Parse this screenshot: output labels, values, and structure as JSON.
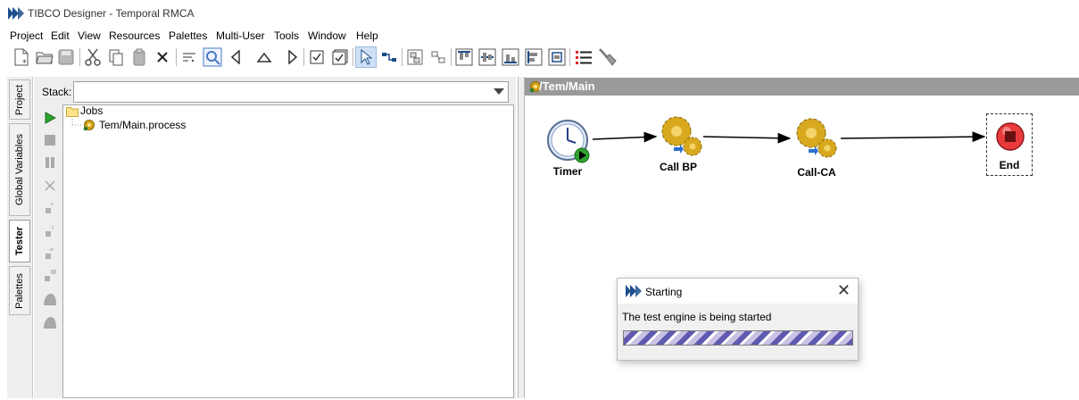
{
  "window": {
    "title": "TIBCO Designer - Temporal RMCA"
  },
  "menu": [
    "Project",
    "Edit",
    "View",
    "Resources",
    "Palettes",
    "Multi-User",
    "Tools",
    "Window",
    "Help"
  ],
  "left_tabs": [
    {
      "label": "Project",
      "active": false
    },
    {
      "label": "Global Variables",
      "active": false
    },
    {
      "label": "Tester",
      "active": true
    },
    {
      "label": "Palettes",
      "active": false
    }
  ],
  "tester": {
    "stack_label": "Stack:",
    "stack_value": "",
    "tree": {
      "root": "Jobs",
      "child": "Tem/Main.process"
    }
  },
  "design": {
    "title": "/Tem/Main",
    "nodes": [
      {
        "label": "Timer",
        "icon": "timer-clock-icon"
      },
      {
        "label": "Call BP",
        "icon": "call-process-icon"
      },
      {
        "label": "Call-CA",
        "icon": "call-process-icon"
      },
      {
        "label": "End",
        "icon": "end-stop-icon"
      }
    ]
  },
  "dialog": {
    "title": "Starting",
    "message": "The test engine is being started",
    "close_symbol": "✕"
  },
  "colors": {
    "accent": "#1c4d8c",
    "design_header": "#9a9a9a",
    "progress": "#5f5ab0"
  }
}
